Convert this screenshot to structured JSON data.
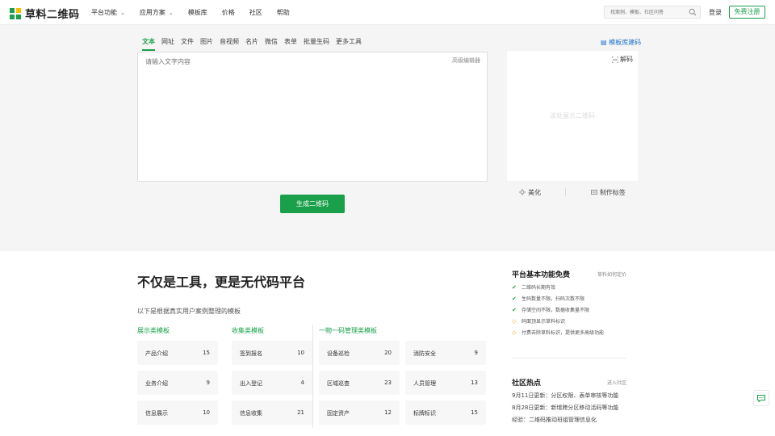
{
  "header": {
    "logo_text": "草料二维码",
    "nav": [
      {
        "label": "平台功能",
        "has_dropdown": true
      },
      {
        "label": "应用方案",
        "has_dropdown": true
      },
      {
        "label": "模板库",
        "has_dropdown": false
      },
      {
        "label": "价格",
        "has_dropdown": false
      },
      {
        "label": "社区",
        "has_dropdown": false
      },
      {
        "label": "帮助",
        "has_dropdown": false
      }
    ],
    "search_placeholder": "找案例、模板、社区问答",
    "login": "登录",
    "register": "免费注册"
  },
  "generator": {
    "tabs": [
      "文本",
      "网址",
      "文件",
      "图片",
      "音视频",
      "名片",
      "微信",
      "表单",
      "批量生码",
      "更多工具"
    ],
    "active_tab": "文本",
    "template_link": "模板库建码",
    "editor_placeholder": "请输入文字内容",
    "advanced_editor": "高级编辑器",
    "generate_button": "生成二维码",
    "decode": "解码",
    "qr_placeholder": "该处展示二维码",
    "actions": [
      "美化",
      "制作标签"
    ]
  },
  "intro": {
    "slogan": "不仅是工具，更是无代码平台",
    "subtitle": "以下是根据真实用户案例整理的模板"
  },
  "categories": [
    {
      "title": "展示类模板",
      "items": [
        {
          "name": "产品介绍",
          "count": "15"
        },
        {
          "name": "业务介绍",
          "count": "9"
        },
        {
          "name": "信息展示",
          "count": "10"
        }
      ]
    },
    {
      "title": "收集类模板",
      "items": [
        {
          "name": "签到报名",
          "count": "10"
        },
        {
          "name": "出入登记",
          "count": "4"
        },
        {
          "name": "信息收集",
          "count": "21"
        }
      ]
    },
    {
      "title": "一物一码管理类模板",
      "items": [
        {
          "name": "设备巡检",
          "count": "20"
        },
        {
          "name": "区域巡查",
          "count": "23"
        },
        {
          "name": "固定资产",
          "count": "12"
        },
        {
          "name": "消防安全",
          "count": "9"
        },
        {
          "name": "人员管理",
          "count": "13"
        },
        {
          "name": "标牌标识",
          "count": "15"
        }
      ]
    }
  ],
  "free_features": {
    "title": "平台基本功能免费",
    "link": "草料如何定价",
    "items": [
      {
        "text": "二维码长期有效",
        "status": "ok"
      },
      {
        "text": "生码数量不限，扫码次数不限",
        "status": "ok"
      },
      {
        "text": "存储空间不限，数据收集量不限",
        "status": "ok"
      },
      {
        "text": "码面顶显示草料标识",
        "status": "warn"
      },
      {
        "text": "付费去除草料标识，提供更多高级功能",
        "status": "warn"
      }
    ]
  },
  "community": {
    "title": "社区热点",
    "link": "进入社区",
    "news": [
      "9月11日更新：分区权限、表单审核等功能",
      "8月28日更新：新增跨分区移动活码等功能",
      "经验：二维码推动班组管理信息化"
    ]
  },
  "colors": {
    "accent": "#1aa04a",
    "link": "#1e72c8",
    "warn": "#f0a020"
  }
}
